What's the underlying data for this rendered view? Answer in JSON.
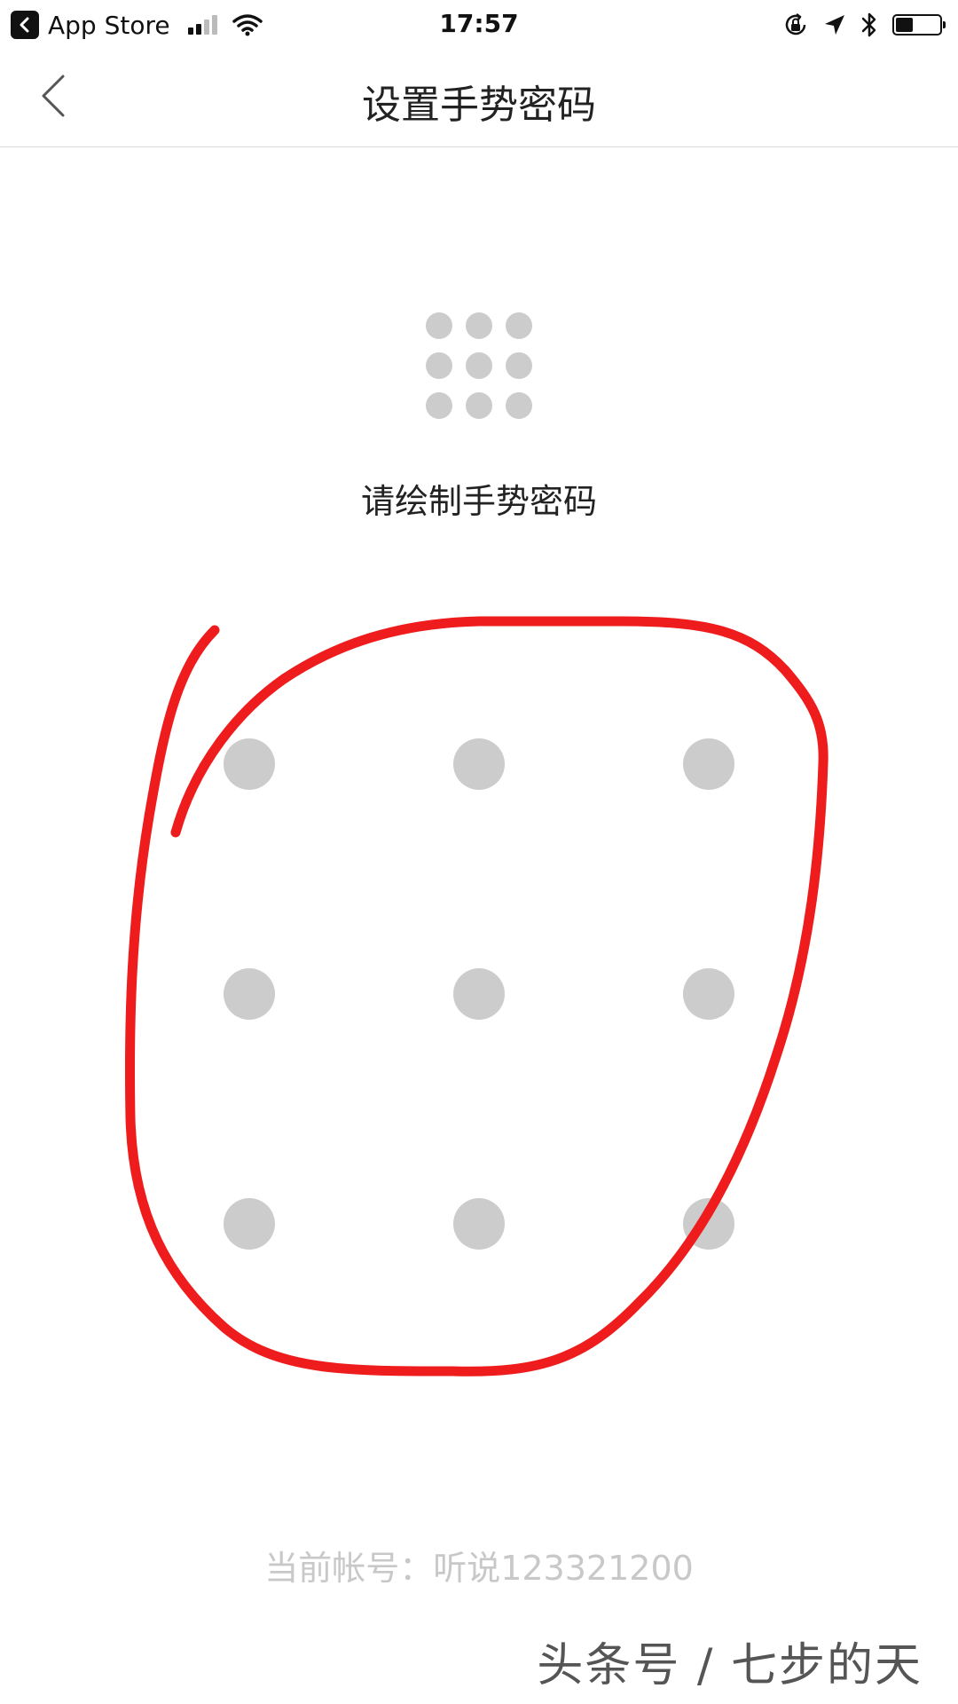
{
  "status_bar": {
    "back_app_label": "App Store",
    "time": "17:57",
    "battery_level": 0.4
  },
  "nav": {
    "title": "设置手势密码"
  },
  "prompt": "请绘制手势密码",
  "gesture_grid": {
    "rows": 3,
    "cols": 3
  },
  "account": {
    "label": "当前帐号：听说123321200"
  },
  "watermark": "头条号 / 七步的天",
  "colors": {
    "stroke": "#ee1c1c",
    "dot": "#cccccc",
    "account_text": "#c8c8c8"
  }
}
